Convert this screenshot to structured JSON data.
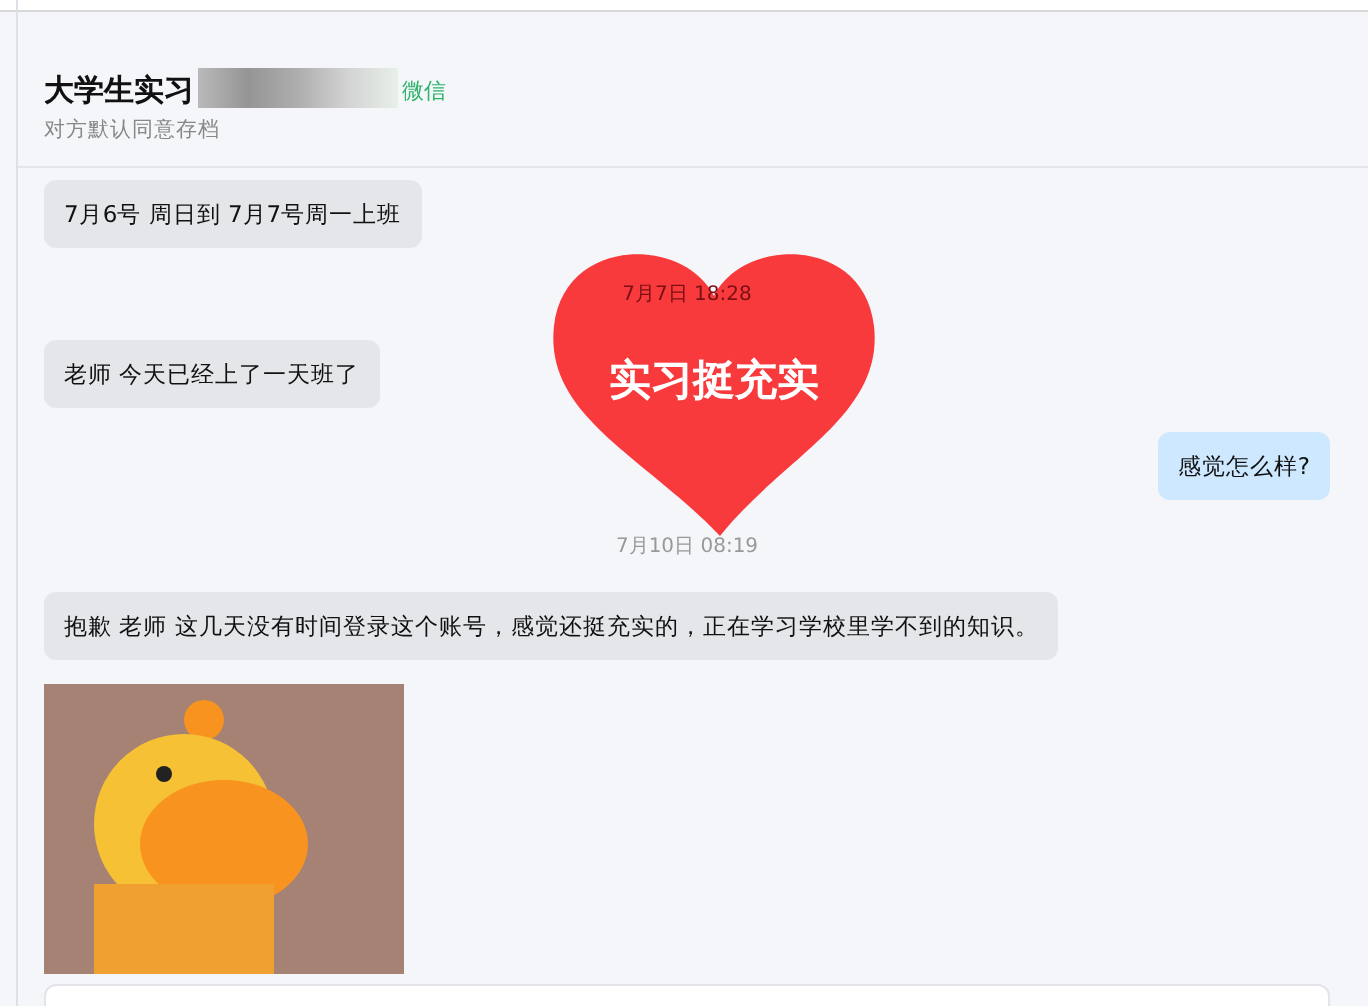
{
  "header": {
    "title": "大学生实习",
    "source": "微信",
    "subtitle": "对方默认同意存档"
  },
  "messages": [
    {
      "kind": "received",
      "text": "7月6号 周日到  7月7号周一上班"
    },
    {
      "kind": "time",
      "text": "7月7日 18:28"
    },
    {
      "kind": "received",
      "text": "老师  今天已经上了一天班了"
    },
    {
      "kind": "sent",
      "text": "感觉怎么样?"
    },
    {
      "kind": "time",
      "text": "7月10日 08:19"
    },
    {
      "kind": "received",
      "text": "抱歉  老师 这几天没有时间登录这个账号，感觉还挺充实的，正在学习学校里学不到的知识。"
    },
    {
      "kind": "image"
    }
  ],
  "sticker": {
    "text": "实习挺充实"
  }
}
